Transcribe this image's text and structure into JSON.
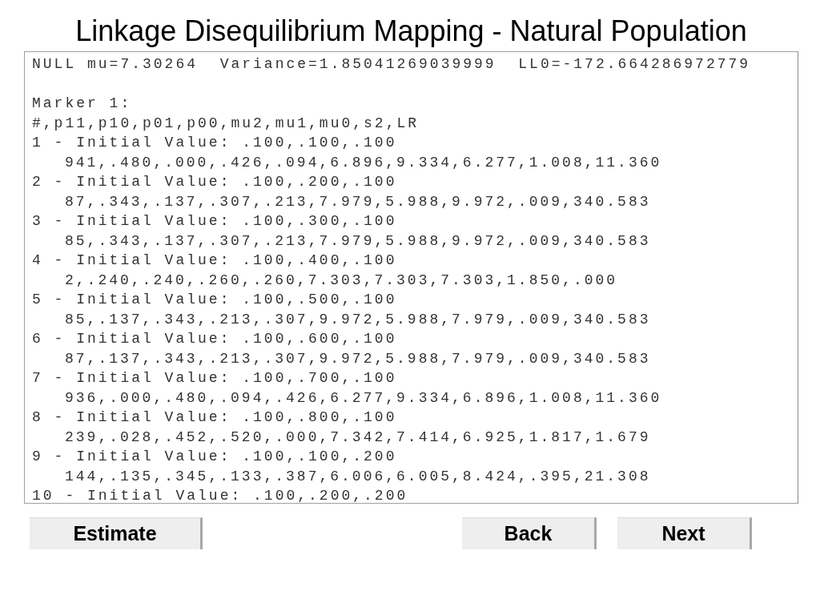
{
  "title": "Linkage Disequilibrium Mapping - Natural Population",
  "output": {
    "summary": "NULL mu=7.30264  Variance=1.85041269039999  LL0=-172.664286972779",
    "marker": "Marker 1:",
    "columns": "#,p11,p10,p01,p00,mu2,mu1,mu0,s2,LR",
    "runs": [
      {
        "initial": "1 - Initial Value: .100,.100,.100",
        "result": "941,.480,.000,.426,.094,6.896,9.334,6.277,1.008,11.360"
      },
      {
        "initial": "2 - Initial Value: .100,.200,.100",
        "result": "87,.343,.137,.307,.213,7.979,5.988,9.972,.009,340.583"
      },
      {
        "initial": "3 - Initial Value: .100,.300,.100",
        "result": "85,.343,.137,.307,.213,7.979,5.988,9.972,.009,340.583"
      },
      {
        "initial": "4 - Initial Value: .100,.400,.100",
        "result": "2,.240,.240,.260,.260,7.303,7.303,7.303,1.850,.000"
      },
      {
        "initial": "5 - Initial Value: .100,.500,.100",
        "result": "85,.137,.343,.213,.307,9.972,5.988,7.979,.009,340.583"
      },
      {
        "initial": "6 - Initial Value: .100,.600,.100",
        "result": "87,.137,.343,.213,.307,9.972,5.988,7.979,.009,340.583"
      },
      {
        "initial": "7 - Initial Value: .100,.700,.100",
        "result": "936,.000,.480,.094,.426,6.277,9.334,6.896,1.008,11.360"
      },
      {
        "initial": "8 - Initial Value: .100,.800,.100",
        "result": "239,.028,.452,.520,.000,7.342,7.414,6.925,1.817,1.679"
      },
      {
        "initial": "9 - Initial Value: .100,.100,.200",
        "result": "144,.135,.345,.133,.387,6.006,6.005,8.424,.395,21.308"
      },
      {
        "initial": "10 - Initial Value: .100,.200,.200"
      }
    ]
  },
  "left_buttons": [
    {
      "label": "Estimate"
    }
  ],
  "right_buttons": [
    {
      "label": "Back"
    },
    {
      "label": "Next"
    }
  ]
}
